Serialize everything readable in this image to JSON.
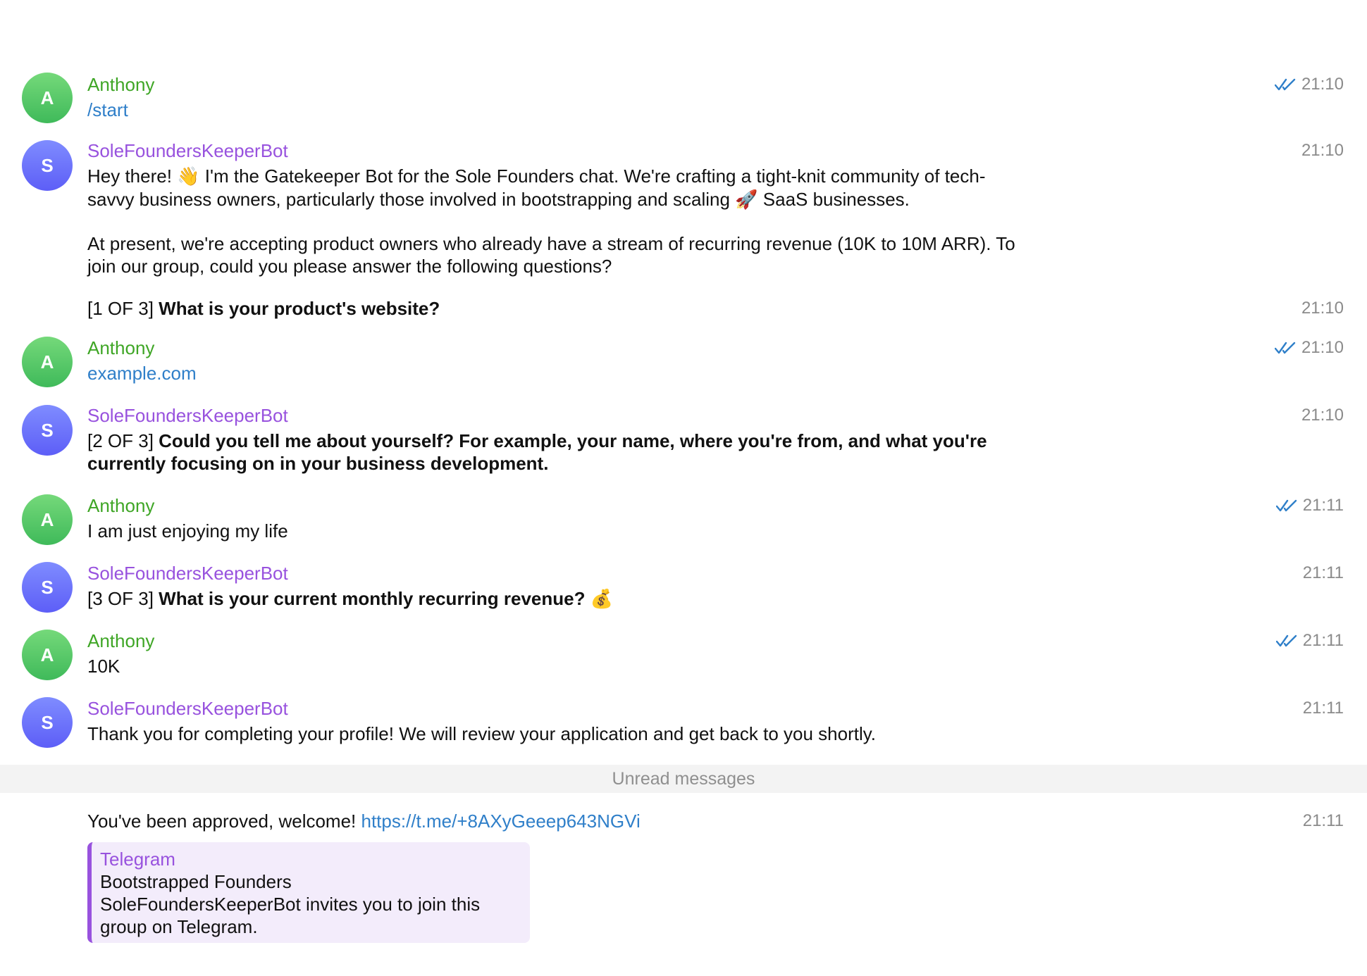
{
  "messages": [
    {
      "sender": "Anthony",
      "avatar_letter": "A",
      "time": "21:10",
      "read": true,
      "link_text": "/start"
    },
    {
      "sender": "SoleFoundersKeeperBot",
      "avatar_letter": "S",
      "time": "21:10",
      "intro_1": "Hey there! ",
      "wave_emoji": "👋",
      "intro_2": " I'm the Gatekeeper Bot for the Sole Founders chat. We're crafting a tight-knit community of tech-savvy business owners, particularly those involved in bootstrapping and scaling ",
      "rocket_emoji": "🚀",
      "intro_3": " SaaS businesses.",
      "paragraph_2": "At present, we're accepting product owners who already have a stream of recurring revenue (10K to 10M ARR). To join our group, could you please answer the following questions?",
      "q_prefix": "[1 OF 3] ",
      "q_text": "What is your product's website?",
      "q_time": "21:10"
    },
    {
      "sender": "Anthony",
      "avatar_letter": "A",
      "time": "21:10",
      "read": true,
      "link_text": "example.com"
    },
    {
      "sender": "SoleFoundersKeeperBot",
      "avatar_letter": "S",
      "time": "21:10",
      "q_prefix": "[2 OF 3] ",
      "q_text": "Could you tell me about yourself? For example, your name, where you're from, and what you're currently focusing on in your business development."
    },
    {
      "sender": "Anthony",
      "avatar_letter": "A",
      "time": "21:11",
      "read": true,
      "text": "I am just enjoying my life"
    },
    {
      "sender": "SoleFoundersKeeperBot",
      "avatar_letter": "S",
      "time": "21:11",
      "q_prefix": "[3 OF 3] ",
      "q_text": "What is your current monthly recurring revenue?",
      "money_emoji": "💰"
    },
    {
      "sender": "Anthony",
      "avatar_letter": "A",
      "time": "21:11",
      "read": true,
      "text": "10K"
    },
    {
      "sender": "SoleFoundersKeeperBot",
      "avatar_letter": "S",
      "time": "21:11",
      "text": "Thank you for completing your profile! We will review your application and get back to you shortly."
    }
  ],
  "unread_label": "Unread messages",
  "approval": {
    "text": "You've been approved, welcome! ",
    "link": "https://t.me/+8AXyGeeep643NGVi",
    "time": "21:11",
    "preview": {
      "site": "Telegram",
      "title": "Bootstrapped Founders",
      "description": "SoleFoundersKeeperBot invites you to join this group on Telegram."
    }
  },
  "colors": {
    "user_name": "#3fa626",
    "bot_name": "#9852de",
    "link": "#2f7fc9",
    "read_check": "#2f7fc9",
    "time": "#8b8b8b"
  }
}
